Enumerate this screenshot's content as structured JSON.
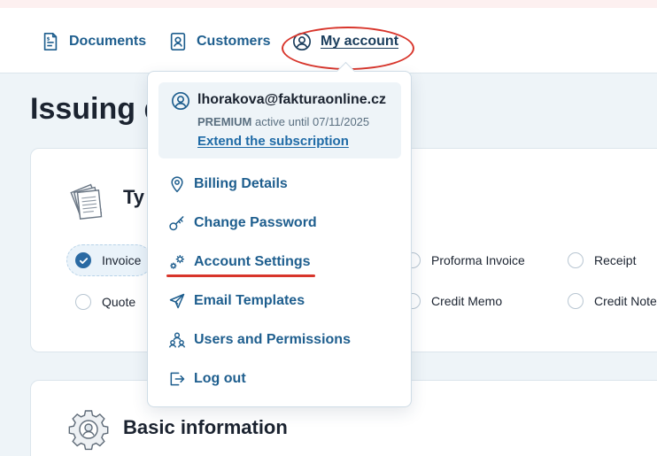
{
  "nav": {
    "documents": "Documents",
    "customers": "Customers",
    "my_account": "My account"
  },
  "page": {
    "title_visible": "Issuing d"
  },
  "document_type": {
    "heading_visible": "Ty",
    "options": [
      {
        "label": "Invoice",
        "checked": true
      },
      {
        "label": "Quote",
        "checked": false
      },
      {
        "label": "Proforma Invoice",
        "checked": false
      },
      {
        "label": "Credit Memo",
        "checked": false
      },
      {
        "label": "Receipt",
        "checked": false
      },
      {
        "label": "Credit Note",
        "checked": false
      }
    ]
  },
  "basic_info": {
    "heading": "Basic information"
  },
  "account_menu": {
    "email": "lhorakova@fakturaonline.cz",
    "plan": "PREMIUM",
    "plan_status": "active until 07/11/2025",
    "extend_link": "Extend the subscription",
    "items": [
      {
        "label": "Billing Details",
        "icon": "map-pin-icon"
      },
      {
        "label": "Change Password",
        "icon": "key-icon"
      },
      {
        "label": "Account Settings",
        "icon": "gears-icon"
      },
      {
        "label": "Email Templates",
        "icon": "paper-plane-icon"
      },
      {
        "label": "Users and Permissions",
        "icon": "users-icon"
      },
      {
        "label": "Log out",
        "icon": "logout-icon"
      }
    ]
  },
  "colors": {
    "accent": "#1e5e8e",
    "link": "#1e6aa6",
    "highlight": "#d8352b",
    "checked": "#2a6aa3"
  }
}
